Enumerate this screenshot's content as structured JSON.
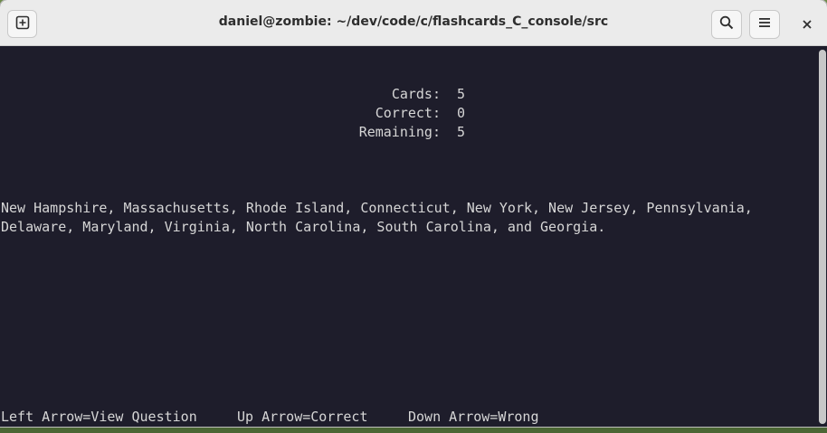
{
  "window": {
    "title": "daniel@zombie: ~/dev/code/c/flashcards_C_console/src"
  },
  "headerbar": {
    "new_tab_icon": "new-tab-icon",
    "search_icon": "search-icon",
    "menu_icon": "hamburger-menu-icon",
    "close_icon": "close-icon"
  },
  "stats": [
    {
      "label": "Cards:",
      "value": "5"
    },
    {
      "label": "Correct:",
      "value": "0"
    },
    {
      "label": "Remaining:",
      "value": "5"
    }
  ],
  "answer_lines": [
    "New Hampshire, Massachusetts, Rhode Island, Connecticut, New York, New Jersey, Pennsylvania,",
    "Delaware, Maryland, Virginia, North Carolina, South Carolina, and Georgia."
  ],
  "help_bar": [
    "Left Arrow=View Question",
    "Up Arrow=Correct",
    "Down Arrow=Wrong"
  ],
  "colors": {
    "terminal_bg": "#1e1d2b",
    "terminal_fg": "#d6d6d6",
    "headerbar_bg": "#ebebeb"
  }
}
